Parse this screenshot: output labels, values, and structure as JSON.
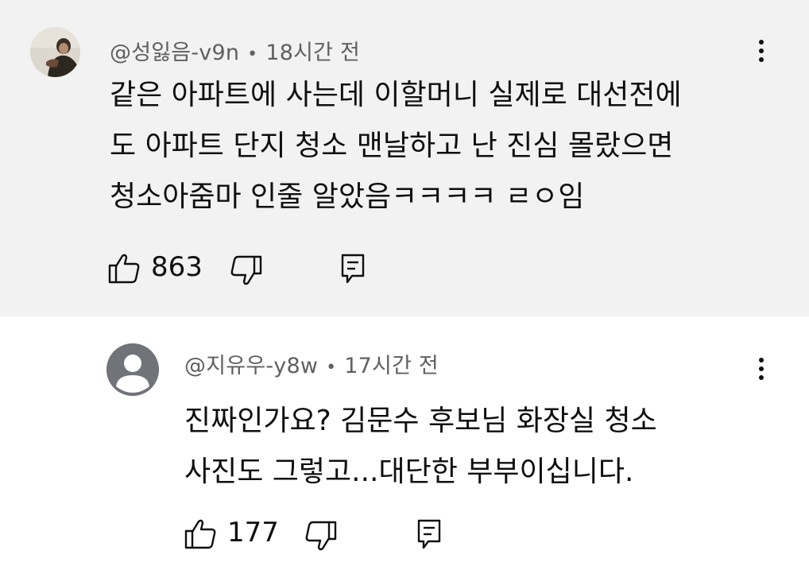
{
  "comments": [
    {
      "author": "@성잃음-v9n",
      "separator": "•",
      "time": "18시간 전",
      "lines": [
        "같은 아파트에 사는데 이할머니 실제로 대선전에",
        "도 아파트 단지 청소 맨날하고 난 진심 몰랐으면",
        "청소아줌마 인줄 알았음ㅋㅋㅋㅋ ㄹㅇ임"
      ],
      "likes": "863",
      "avatar_icon": "user-photo-avatar",
      "colors": {
        "background": "#f2f2f2"
      }
    },
    {
      "author": "@지유우-y8w",
      "separator": "•",
      "time": "17시간 전",
      "lines": [
        "진짜인가요? 김문수 후보님 화장실 청소",
        "사진도 그렇고...대단한 부부이십니다."
      ],
      "likes": "177",
      "avatar_icon": "default-user-avatar",
      "colors": {
        "background": "#ffffff"
      }
    }
  ],
  "icons": {
    "like": "thumbs-up-icon",
    "dislike": "thumbs-down-icon",
    "reply": "reply-comment-icon",
    "more": "more-options-icon"
  },
  "colors": {
    "meta_text": "#606060",
    "body_text": "#0f0f0f"
  }
}
